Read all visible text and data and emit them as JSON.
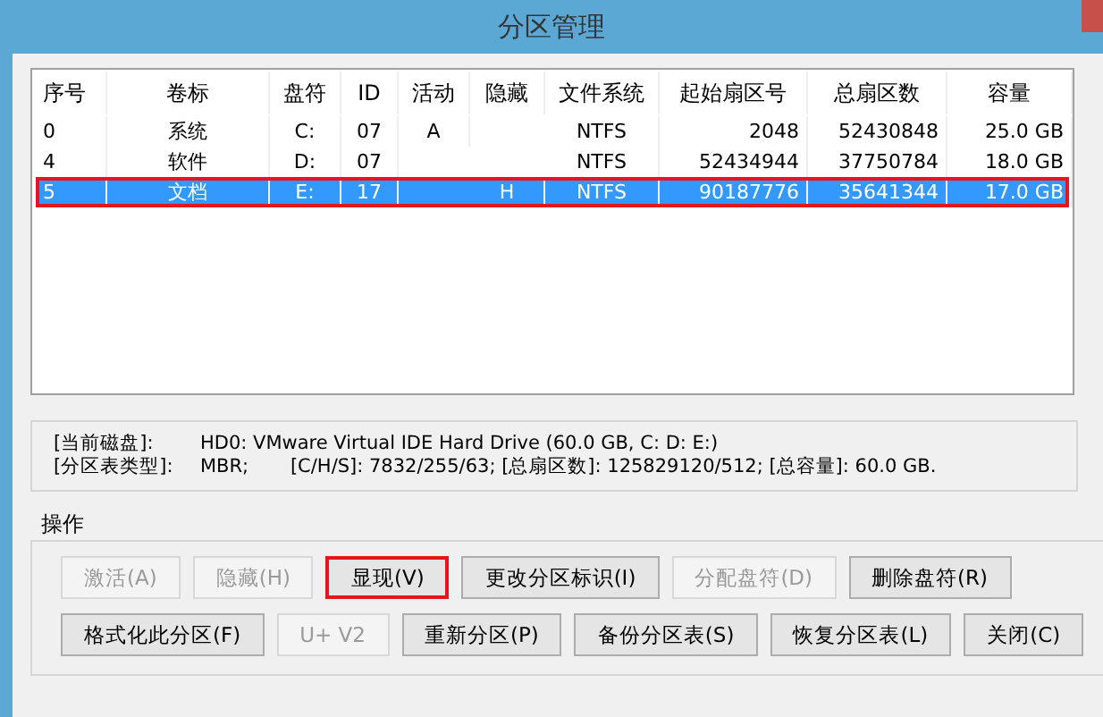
{
  "window": {
    "title": "分区管理"
  },
  "table": {
    "columns": [
      "序号",
      "卷标",
      "盘符",
      "ID",
      "活动",
      "隐藏",
      "文件系统",
      "起始扇区号",
      "总扇区数",
      "容量"
    ],
    "rows": [
      {
        "cells": [
          "0",
          "系统",
          "C:",
          "07",
          "A",
          "",
          "NTFS",
          "2048",
          "52430848",
          "25.0 GB"
        ],
        "selected": false
      },
      {
        "cells": [
          "4",
          "软件",
          "D:",
          "07",
          "",
          "",
          "NTFS",
          "52434944",
          "37750784",
          "18.0 GB"
        ],
        "selected": false
      },
      {
        "cells": [
          "5",
          "文档",
          "E:",
          "17",
          "",
          "H",
          "NTFS",
          "90187776",
          "35641344",
          "17.0 GB"
        ],
        "selected": true
      }
    ]
  },
  "info": [
    {
      "label": "[当前磁盘]:",
      "value": "HD0: VMware Virtual IDE Hard Drive (60.0 GB, C: D: E:)"
    },
    {
      "label": "[分区表类型]:",
      "value": "MBR;       [C/H/S]: 7832/255/63; [总扇区数]: 125829120/512; [总容量]: 60.0 GB."
    }
  ],
  "operations": {
    "title": "操作",
    "rows": [
      [
        {
          "label": "激活(A)",
          "disabled": true,
          "focused": false
        },
        {
          "label": "隐藏(H)",
          "disabled": true,
          "focused": false
        },
        {
          "label": "显现(V)",
          "disabled": false,
          "focused": true
        },
        {
          "label": "更改分区标识(I)",
          "disabled": false,
          "focused": false
        },
        {
          "label": "分配盘符(D)",
          "disabled": true,
          "focused": false
        },
        {
          "label": "删除盘符(R)",
          "disabled": false,
          "focused": false
        }
      ],
      [
        {
          "label": "格式化此分区(F)",
          "disabled": false,
          "focused": false
        },
        {
          "label": "U+ V2",
          "disabled": true,
          "focused": false
        },
        {
          "label": "重新分区(P)",
          "disabled": false,
          "focused": false
        },
        {
          "label": "备份分区表(S)",
          "disabled": false,
          "focused": false
        },
        {
          "label": "恢复分区表(L)",
          "disabled": false,
          "focused": false
        },
        {
          "label": "关闭(C)",
          "disabled": false,
          "focused": false
        }
      ]
    ]
  }
}
